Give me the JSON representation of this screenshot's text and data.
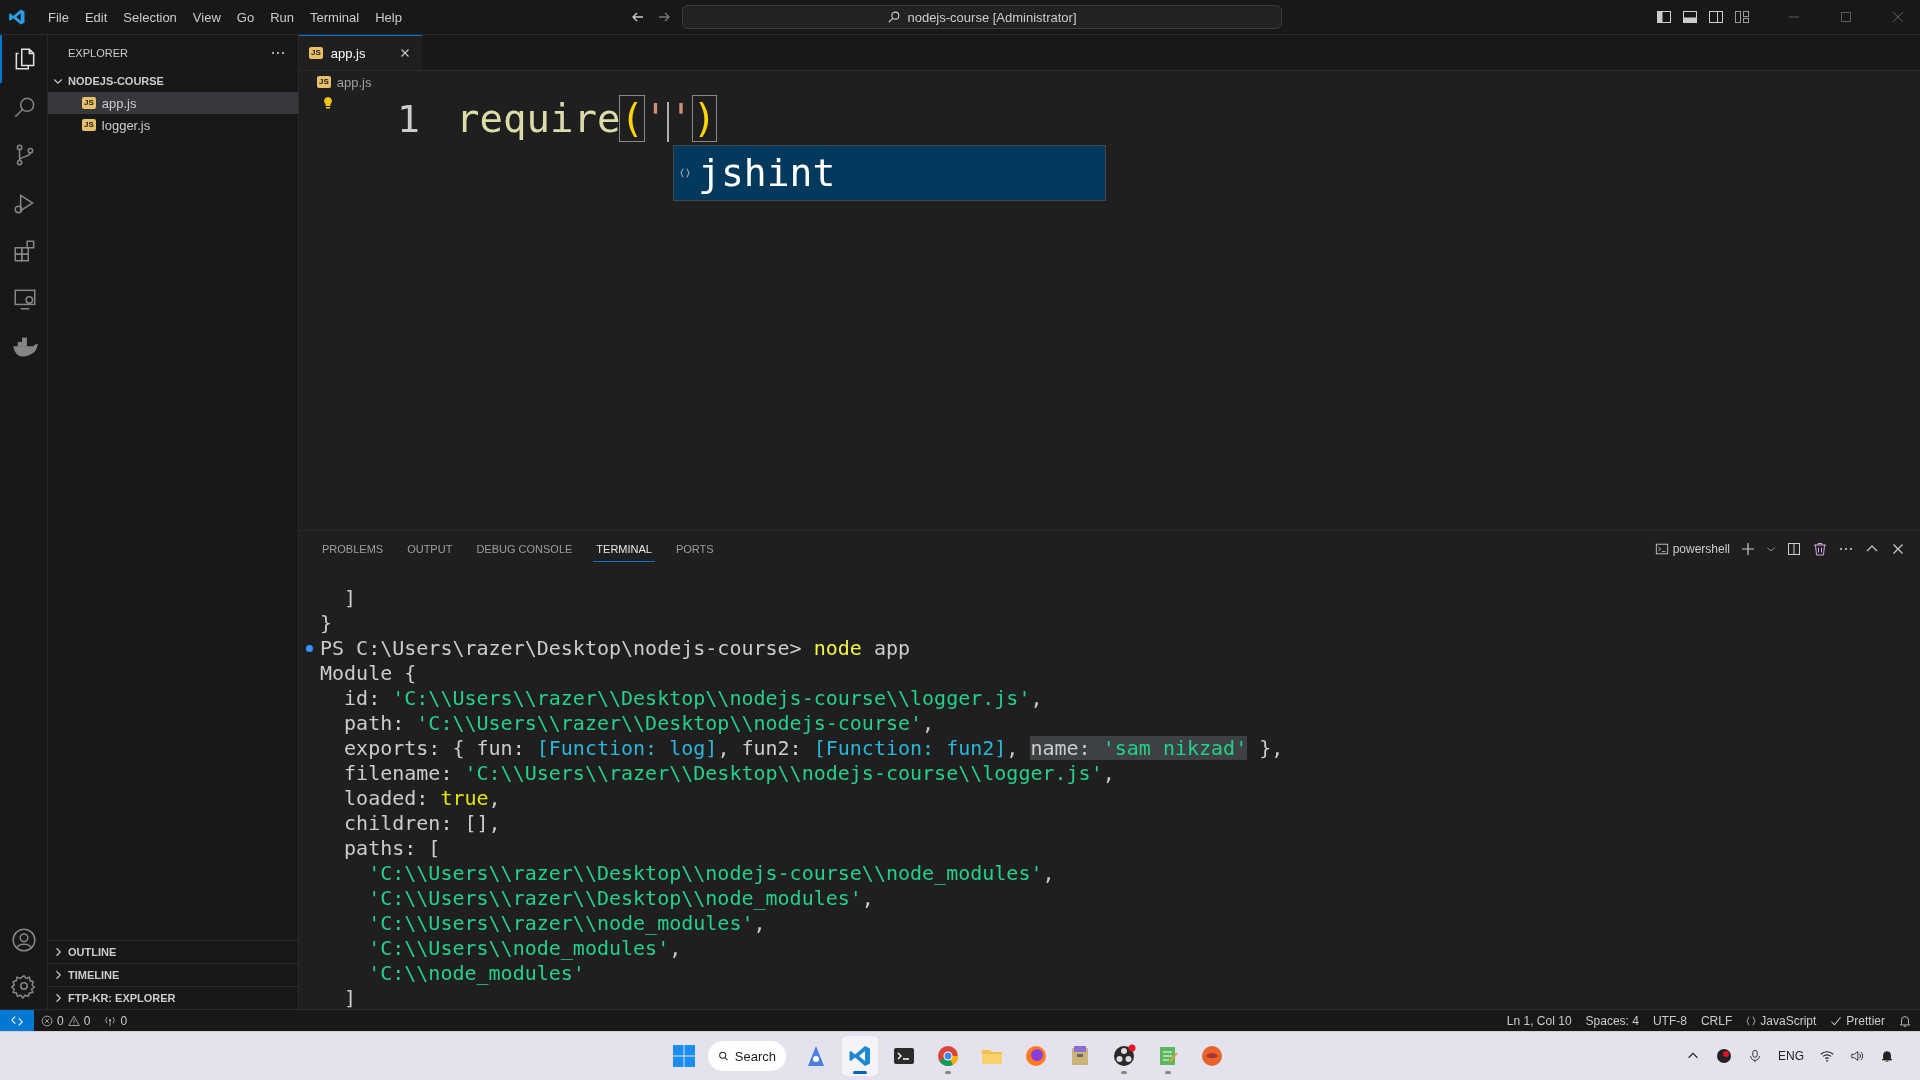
{
  "title_bar": {
    "menu": [
      "File",
      "Edit",
      "Selection",
      "View",
      "Go",
      "Run",
      "Terminal",
      "Help"
    ],
    "command_center": "nodejs-course [Administrator]"
  },
  "activity_bar": [
    {
      "kind": "explorer",
      "selected": true
    },
    {
      "kind": "search",
      "selected": false
    },
    {
      "kind": "source-control",
      "selected": false
    },
    {
      "kind": "run",
      "selected": false
    },
    {
      "kind": "extensions",
      "selected": false
    },
    {
      "kind": "remote",
      "selected": false
    },
    {
      "kind": "docker",
      "selected": false
    }
  ],
  "sidebar": {
    "title": "EXPLORER",
    "folder": {
      "name": "NODEJS-COURSE",
      "expanded": true,
      "files": [
        {
          "icon": "JS",
          "name": "app.js",
          "selected": true
        },
        {
          "icon": "JS",
          "name": "logger.js",
          "selected": false
        }
      ]
    },
    "sections": [
      {
        "name": "OUTLINE",
        "expanded": false
      },
      {
        "name": "TIMELINE",
        "expanded": false
      },
      {
        "name": "FTP-KR: EXPLORER",
        "expanded": false
      }
    ]
  },
  "tabs": [
    {
      "icon": "JS",
      "label": "app.js",
      "selected": true
    }
  ],
  "breadcrumb": {
    "icon": "JS",
    "label": "app.js"
  },
  "editor": {
    "line_number": "1",
    "tokens": [
      {
        "text": "require",
        "kind": "function"
      },
      {
        "text": "(",
        "kind": "bracket"
      },
      {
        "text": "'",
        "kind": "string",
        "cursor_after": true
      },
      {
        "text": "'",
        "kind": "string"
      },
      {
        "text": ")",
        "kind": "bracket"
      }
    ],
    "suggestions": [
      {
        "label": "jshint",
        "selected": true
      }
    ]
  },
  "panel": {
    "tabs": [
      {
        "label": "PROBLEMS",
        "selected": false
      },
      {
        "label": "OUTPUT",
        "selected": false
      },
      {
        "label": "DEBUG CONSOLE",
        "selected": false
      },
      {
        "label": "TERMINAL",
        "selected": true
      },
      {
        "label": "PORTS",
        "selected": false
      }
    ],
    "terminal_name": "powershell",
    "lines": [
      {
        "segments": [
          {
            "text": "  ]",
            "kind": "text"
          }
        ]
      },
      {
        "segments": [
          {
            "text": "}",
            "kind": "text"
          }
        ]
      },
      {
        "marker": true,
        "segments": [
          {
            "text": "PS C:\\Users\\razer\\Desktop\\nodejs-course> ",
            "kind": "text"
          },
          {
            "text": "node",
            "kind": "command"
          },
          {
            "text": " app",
            "kind": "text"
          }
        ]
      },
      {
        "segments": [
          {
            "text": "Module {",
            "kind": "text"
          }
        ]
      },
      {
        "segments": [
          {
            "text": "  id: ",
            "kind": "text"
          },
          {
            "text": "'C:\\\\Users\\\\razer\\\\Desktop\\\\nodejs-course\\\\logger.js'",
            "kind": "string"
          },
          {
            "text": ",",
            "kind": "text"
          }
        ]
      },
      {
        "segments": [
          {
            "text": "  path: ",
            "kind": "text"
          },
          {
            "text": "'C:\\\\Users\\\\razer\\\\Desktop\\\\nodejs-course'",
            "kind": "string"
          },
          {
            "text": ",",
            "kind": "text"
          }
        ]
      },
      {
        "segments": [
          {
            "text": "  exports: { fun: ",
            "kind": "text"
          },
          {
            "text": "[Function: log]",
            "kind": "function"
          },
          {
            "text": ", fun2: ",
            "kind": "text"
          },
          {
            "text": "[Function: fun2]",
            "kind": "function"
          },
          {
            "text": ", ",
            "kind": "text"
          },
          {
            "text": "name: ",
            "kind": "text",
            "highlighted": true
          },
          {
            "text": "'sam nikzad'",
            "kind": "string",
            "highlighted": true
          },
          {
            "text": " },",
            "kind": "text"
          }
        ]
      },
      {
        "segments": [
          {
            "text": "  filename: ",
            "kind": "text"
          },
          {
            "text": "'C:\\\\Users\\\\razer\\\\Desktop\\\\nodejs-course\\\\logger.js'",
            "kind": "string"
          },
          {
            "text": ",",
            "kind": "text"
          }
        ]
      },
      {
        "segments": [
          {
            "text": "  loaded: ",
            "kind": "text"
          },
          {
            "text": "true",
            "kind": "keyword"
          },
          {
            "text": ",",
            "kind": "text"
          }
        ]
      },
      {
        "segments": [
          {
            "text": "  children: [],",
            "kind": "text"
          }
        ]
      },
      {
        "segments": [
          {
            "text": "  paths: [",
            "kind": "text"
          }
        ]
      },
      {
        "segments": [
          {
            "text": "    'C:\\\\Users\\\\razer\\\\Desktop\\\\nodejs-course\\\\node_modules'",
            "kind": "string"
          },
          {
            "text": ",",
            "kind": "text"
          }
        ]
      },
      {
        "segments": [
          {
            "text": "    'C:\\\\Users\\\\razer\\\\Desktop\\\\node_modules'",
            "kind": "string"
          },
          {
            "text": ",",
            "kind": "text"
          }
        ]
      },
      {
        "segments": [
          {
            "text": "    'C:\\\\Users\\\\razer\\\\node_modules'",
            "kind": "string"
          },
          {
            "text": ",",
            "kind": "text"
          }
        ]
      },
      {
        "segments": [
          {
            "text": "    'C:\\\\Users\\\\node_modules'",
            "kind": "string"
          },
          {
            "text": ",",
            "kind": "text"
          }
        ]
      },
      {
        "segments": [
          {
            "text": "    'C:\\\\node_modules'",
            "kind": "string"
          }
        ]
      },
      {
        "segments": [
          {
            "text": "  ]",
            "kind": "text"
          }
        ]
      }
    ]
  },
  "status_bar": {
    "errors": "0",
    "warnings": "0",
    "ports": "0",
    "right": [
      {
        "kind": "plain",
        "text": "Ln 1, Col 10"
      },
      {
        "kind": "plain",
        "text": "Spaces: 4"
      },
      {
        "kind": "plain",
        "text": "UTF-8"
      },
      {
        "kind": "plain",
        "text": "CRLF"
      },
      {
        "kind": "language",
        "text": "JavaScript"
      },
      {
        "kind": "prettier",
        "text": "Prettier"
      }
    ]
  },
  "taskbar": {
    "search": "Search",
    "apps": [
      {
        "kind": "copilot",
        "running": false,
        "selected": false
      },
      {
        "kind": "vscode",
        "running": true,
        "selected": true
      },
      {
        "kind": "terminal",
        "running": false,
        "selected": false
      },
      {
        "kind": "chrome",
        "running": true,
        "selected": false
      },
      {
        "kind": "files",
        "running": false,
        "selected": false
      },
      {
        "kind": "firefox",
        "running": false,
        "selected": false
      },
      {
        "kind": "archive",
        "running": false,
        "selected": false
      },
      {
        "kind": "obs",
        "running": true,
        "selected": false
      },
      {
        "kind": "notepad",
        "running": true,
        "selected": false
      },
      {
        "kind": "app",
        "running": false,
        "selected": false
      }
    ],
    "language": "ENG"
  }
}
